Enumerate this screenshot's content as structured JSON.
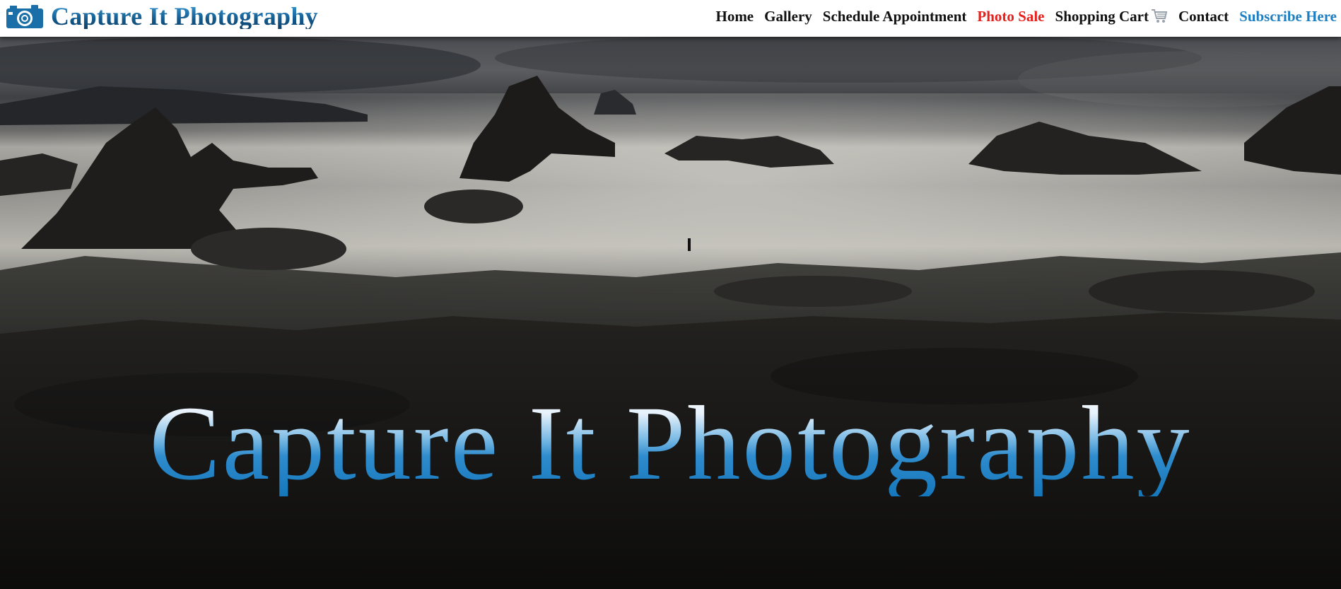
{
  "brand": {
    "title": "Capture It Photography",
    "icon": "camera-icon",
    "color": "#1a6fa8"
  },
  "nav": {
    "items": [
      {
        "label": "Home"
      },
      {
        "label": "Gallery"
      },
      {
        "label": "Schedule Appointment"
      },
      {
        "label": "Photo Sale",
        "color": "#e8201c"
      },
      {
        "label": "Shopping Cart",
        "icon": "shopping-cart-icon"
      },
      {
        "label": "Contact"
      },
      {
        "label": "Subscribe Here",
        "color": "#1e7fc0"
      }
    ]
  },
  "hero": {
    "title": "Capture It Photography",
    "image": "rocky-coastline-photo"
  }
}
